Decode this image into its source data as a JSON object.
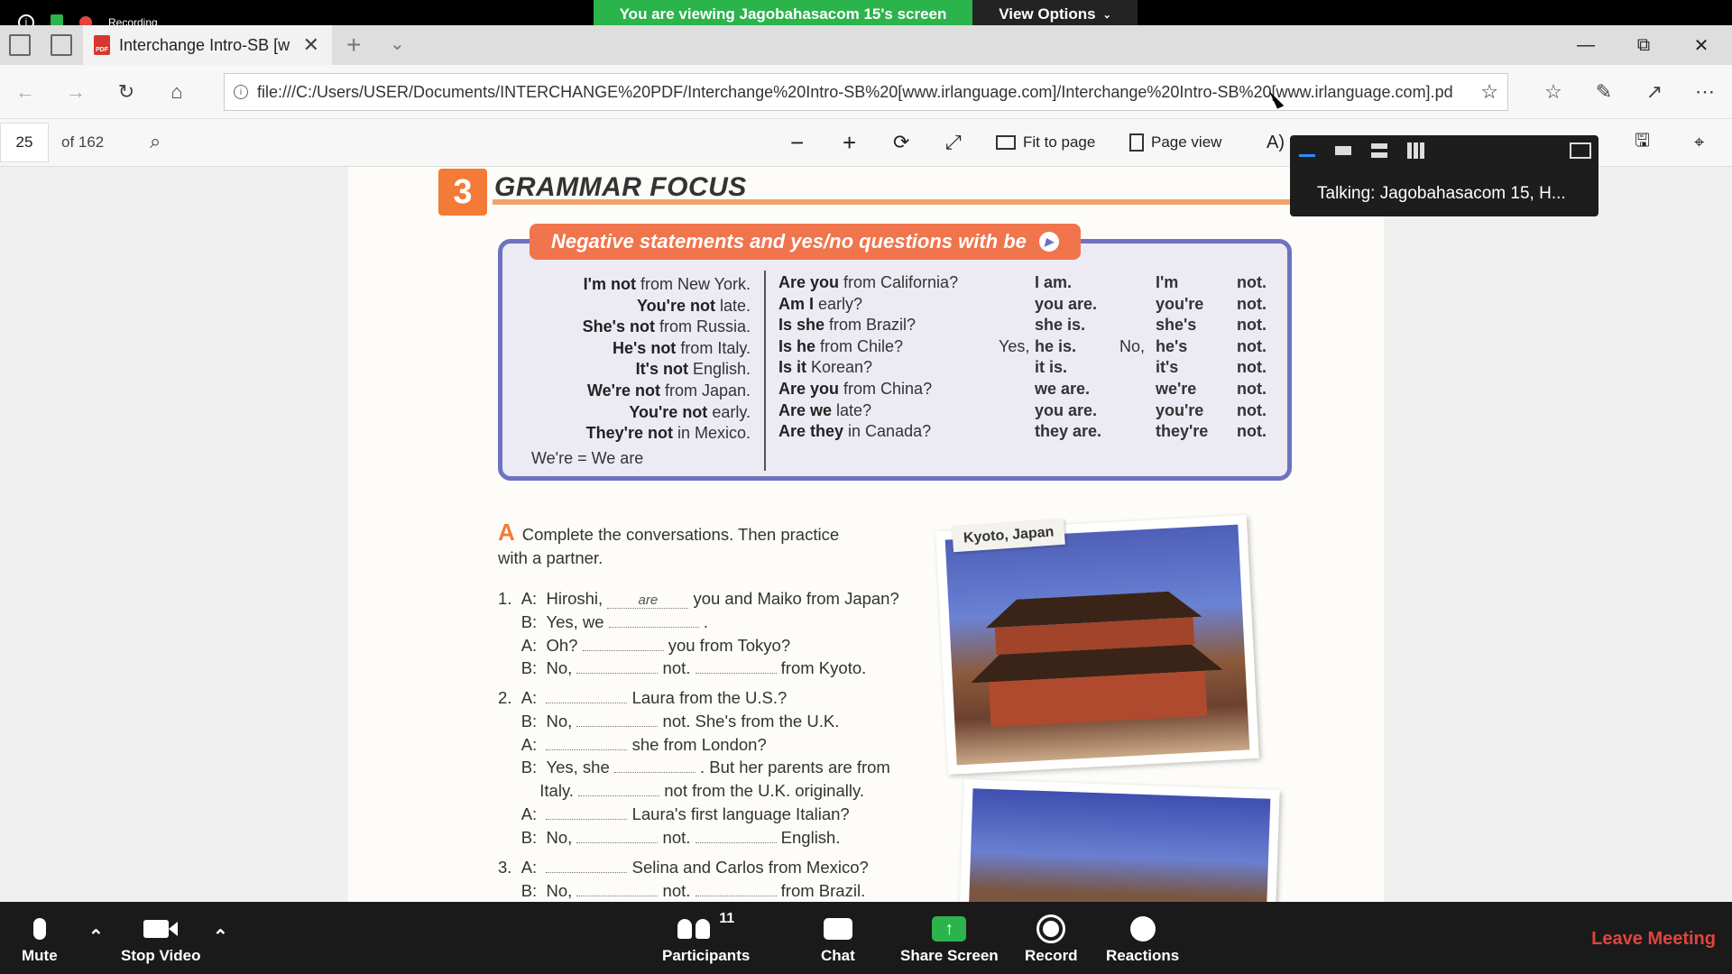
{
  "zoom": {
    "share_banner": "You are viewing Jagobahasacom 15's screen",
    "view_options": "View Options",
    "recording": "Recording",
    "panel_talking": "Talking: Jagobahasacom 15, H...",
    "participants_count": "11",
    "toolbar": {
      "mute": "Mute",
      "stop_video": "Stop Video",
      "participants": "Participants",
      "chat": "Chat",
      "share_screen": "Share Screen",
      "record": "Record",
      "reactions": "Reactions",
      "leave": "Leave Meeting"
    }
  },
  "browser": {
    "tab_title": "Interchange Intro-SB [w",
    "url": "file:///C:/Users/USER/Documents/INTERCHANGE%20PDF/Interchange%20Intro-SB%20[www.irlanguage.com]/Interchange%20Intro-SB%20[www.irlanguage.com].pd"
  },
  "pdf": {
    "page_number": "25",
    "page_total": "of 162",
    "fit_to_page": "Fit to page",
    "page_view": "Page view"
  },
  "page": {
    "section_num": "3",
    "section_title": "GRAMMAR FOCUS",
    "box_header": "Negative statements and yes/no questions with be",
    "col1": [
      {
        "b": "I'm not",
        "t": " from New York."
      },
      {
        "b": "You're not",
        "t": " late."
      },
      {
        "b": "She's not",
        "t": " from Russia."
      },
      {
        "b": "He's not",
        "t": " from Italy."
      },
      {
        "b": "It's not",
        "t": " English."
      },
      {
        "b": "We're not",
        "t": " from Japan."
      },
      {
        "b": "You're not",
        "t": " early."
      },
      {
        "b": "They're not",
        "t": " in Mexico."
      }
    ],
    "note": "We're = We are",
    "col2": [
      {
        "b": "Are you",
        "t": " from California?"
      },
      {
        "b": "Am I",
        "t": " early?"
      },
      {
        "b": "Is she",
        "t": " from Brazil?"
      },
      {
        "b": "Is he",
        "t": " from Chile?"
      },
      {
        "b": "Is it",
        "t": " Korean?"
      },
      {
        "b": "Are you",
        "t": " from China?"
      },
      {
        "b": "Are we",
        "t": " late?"
      },
      {
        "b": "Are they",
        "t": " in Canada?"
      }
    ],
    "col3": [
      "I am.",
      "you are.",
      "she is.",
      "he is.",
      "it is.",
      "we are.",
      "you are.",
      "they are."
    ],
    "col4": [
      "I'm",
      "you're",
      "she's",
      "he's",
      "it's",
      "we're",
      "you're",
      "they're"
    ],
    "col5": [
      "not.",
      "not.",
      "not.",
      "not.",
      "not.",
      "not.",
      "not.",
      "not."
    ],
    "yes_label": "Yes,",
    "no_label": "No,",
    "sectionA_letter": "A",
    "sectionA_line1": "Complete the conversations. Then practice",
    "sectionA_line2": "with a partner.",
    "photo_label": "Kyoto, Japan",
    "example_answer": "are"
  }
}
